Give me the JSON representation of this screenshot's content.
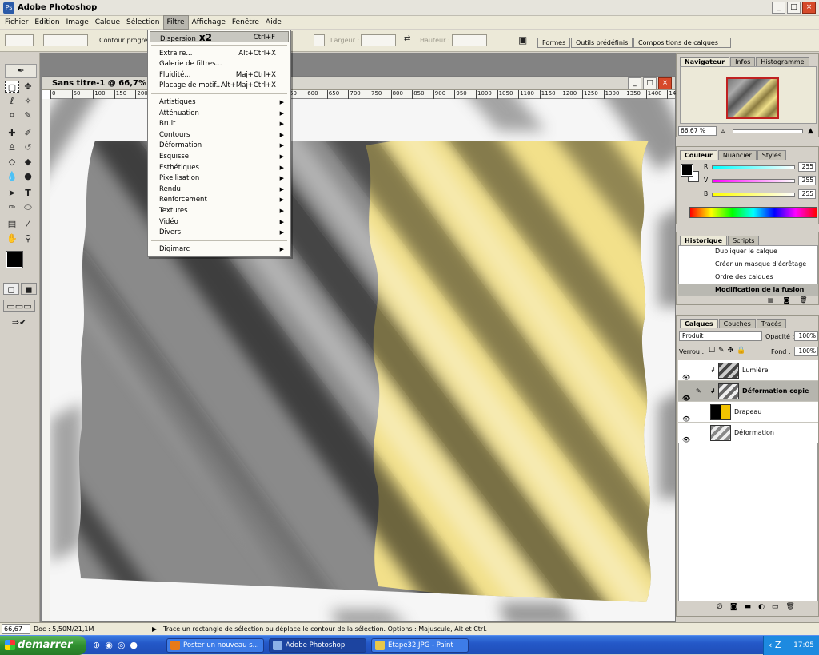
{
  "app": {
    "title": "Adobe Photoshop",
    "logo": "ps-logo-icon"
  },
  "window_buttons": [
    "_",
    "□",
    "×"
  ],
  "menubar": [
    "Fichier",
    "Edition",
    "Image",
    "Calque",
    "Sélection",
    "Filtre",
    "Affichage",
    "Fenêtre",
    "Aide"
  ],
  "menubar_active": "Filtre",
  "options": {
    "contour_label": "Contour progre",
    "largeur_label": "Largeur :",
    "hauteur_label": "Hauteur :",
    "wells": [
      "Formes",
      "Outils prédéfinis",
      "Compositions de calques"
    ]
  },
  "document": {
    "title": "Sans titre-1 @ 66,7% (De"
  },
  "ruler_ticks": [
    "0",
    "50",
    "100",
    "150",
    "200",
    "250",
    "300",
    "350",
    "400",
    "450",
    "500",
    "550",
    "600",
    "650",
    "700",
    "750",
    "800",
    "850",
    "900",
    "950",
    "1000",
    "1050",
    "1100",
    "1150",
    "1200",
    "1250",
    "1300",
    "1350",
    "1400",
    "14"
  ],
  "filter_menu": {
    "top": [
      {
        "label": "Dispersion",
        "shortcut": "Ctrl+F",
        "note": "x2",
        "highlight": true
      }
    ],
    "group2": [
      {
        "label": "Extraire...",
        "shortcut": "Alt+Ctrl+X"
      },
      {
        "label": "Galerie de filtres...",
        "shortcut": ""
      },
      {
        "label": "Fluidité...",
        "shortcut": "Maj+Ctrl+X"
      },
      {
        "label": "Placage de motif...",
        "shortcut": "Alt+Maj+Ctrl+X"
      }
    ],
    "submenus": [
      "Artistiques",
      "Atténuation",
      "Bruit",
      "Contours",
      "Déformation",
      "Esquisse",
      "Esthétiques",
      "Pixellisation",
      "Rendu",
      "Renforcement",
      "Textures",
      "Vidéo",
      "Divers"
    ],
    "last": [
      "Digimarc"
    ]
  },
  "navigator": {
    "tabs": [
      "Navigateur",
      "Infos",
      "Histogramme"
    ],
    "zoom": "66,67 %"
  },
  "color": {
    "tabs": [
      "Couleur",
      "Nuancier",
      "Styles"
    ],
    "r_label": "R",
    "v_label": "V",
    "b_label": "B",
    "r": "255",
    "v": "255",
    "b": "255"
  },
  "history": {
    "tabs": [
      "Historique",
      "Scripts"
    ],
    "items": [
      "Dupliquer le calque",
      "Créer un masque d'écrêtage",
      "Ordre des calques",
      "Modification de la fusion"
    ]
  },
  "layers": {
    "tabs": [
      "Calques",
      "Couches",
      "Tracés"
    ],
    "blend_mode": "Produit",
    "opacity_label": "Opacité :",
    "opacity": "100%",
    "lock_label": "Verrou :",
    "fill_label": "Fond :",
    "fill": "100%",
    "items": [
      {
        "name": "Lumière"
      },
      {
        "name": "Déformation copie",
        "selected": true
      },
      {
        "name": "Drapeau"
      },
      {
        "name": "Déformation"
      }
    ]
  },
  "status": {
    "zoom": "66,67 %",
    "doc": "Doc : 5,50M/21,1M",
    "hint": "Trace un rectangle de sélection ou déplace le contour de la sélection. Options : Majuscule, Alt et Ctrl."
  },
  "taskbar": {
    "start": "demarrer",
    "tasks": [
      "Poster un nouveau s...",
      "Adobe Photoshop",
      "Etape32.JPG - Paint"
    ],
    "clock": "17:05"
  },
  "colors": {
    "flag_gray": "#8a8a8a",
    "flag_yellow": "#f2e08a",
    "taskbar": "#2458c8"
  }
}
